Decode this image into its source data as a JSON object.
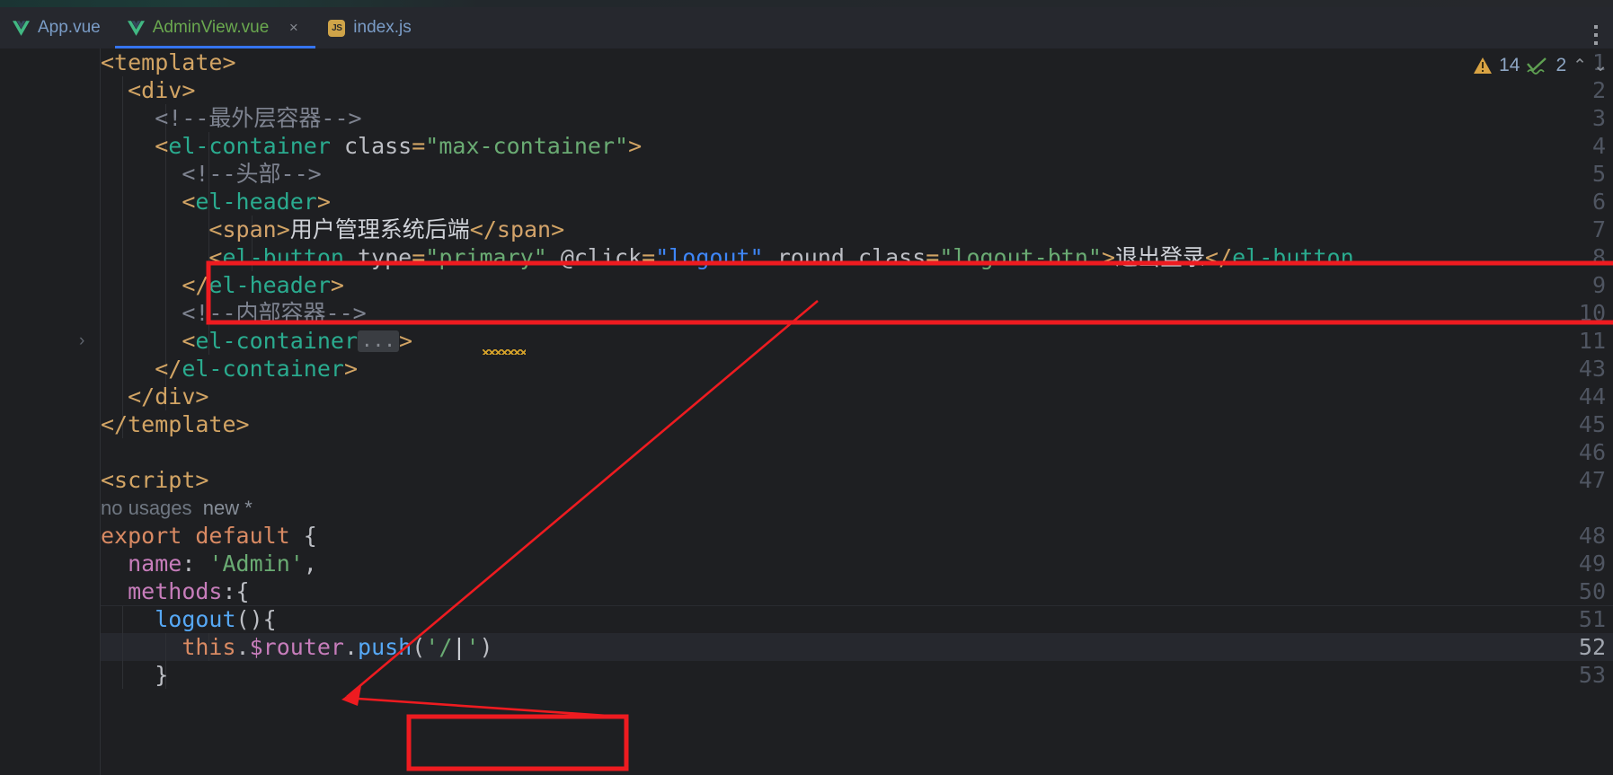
{
  "window": {
    "theme_bg": "#1e1f22",
    "tabbar_bg": "#26282e",
    "accent": "#3574f0",
    "annotation_color": "#ee1b20"
  },
  "tabs": [
    {
      "label": "App.vue",
      "icon": "vue-file-icon",
      "active": false,
      "closable": false
    },
    {
      "label": "AdminView.vue",
      "icon": "vue-file-icon",
      "active": true,
      "closable": true,
      "close_label": "×"
    },
    {
      "label": "index.js",
      "icon": "js-file-icon",
      "active": false,
      "closable": false,
      "icon_text": "JS"
    }
  ],
  "tabbar": {
    "kebab_name": "more-options",
    "js_badge": "JS"
  },
  "inspections": {
    "warning_icon": "warning-triangle-icon",
    "warning_count": "14",
    "ok_icon": "green-check-squiggle-icon",
    "ok_count": "2",
    "prev_label": "⌃",
    "next_label": "⌄"
  },
  "editor": {
    "language": "vue",
    "current_line": 52,
    "caret_column": 26,
    "codelens": {
      "no_usages": "no usages",
      "new_marker": "new *"
    },
    "folded_placeholder": "...",
    "lines": [
      {
        "num": "1",
        "text": "<template>"
      },
      {
        "num": "2",
        "text": "  <div>"
      },
      {
        "num": "3",
        "text": "    <!--最外层容器-->"
      },
      {
        "num": "4",
        "text": "    <el-container class=\"max-container\">"
      },
      {
        "num": "5",
        "text": "      <!--头部-->"
      },
      {
        "num": "6",
        "text": "      <el-header>"
      },
      {
        "num": "7",
        "text": "        <span>用户管理系统后端</span>"
      },
      {
        "num": "8",
        "text": "        <el-button type=\"primary\" @click=\"logout\" round class=\"logout-btn\">退出登录</el-button>"
      },
      {
        "num": "9",
        "text": "      </el-header>"
      },
      {
        "num": "10",
        "text": "      <!--内部容器-->"
      },
      {
        "num": "11",
        "text": "      <el-container...>",
        "folded": true
      },
      {
        "num": "43",
        "text": "    </el-container>"
      },
      {
        "num": "44",
        "text": "  </div>"
      },
      {
        "num": "45",
        "text": "</template>"
      },
      {
        "num": "46",
        "text": ""
      },
      {
        "num": "47",
        "text": "<script>"
      },
      {
        "num": "48",
        "text": "export default {"
      },
      {
        "num": "49",
        "text": "  name: 'Admin',"
      },
      {
        "num": "50",
        "text": "  methods:{"
      },
      {
        "num": "51",
        "text": "    logout(){"
      },
      {
        "num": "52",
        "text": "      this.$router.push('/')"
      },
      {
        "num": "53",
        "text": "    }"
      }
    ]
  },
  "annotations": {
    "box_button_line": "highlight-el-button-line",
    "box_push_call": "highlight-router-push",
    "arrow": "arrow-from-push-to-logout-handler"
  }
}
